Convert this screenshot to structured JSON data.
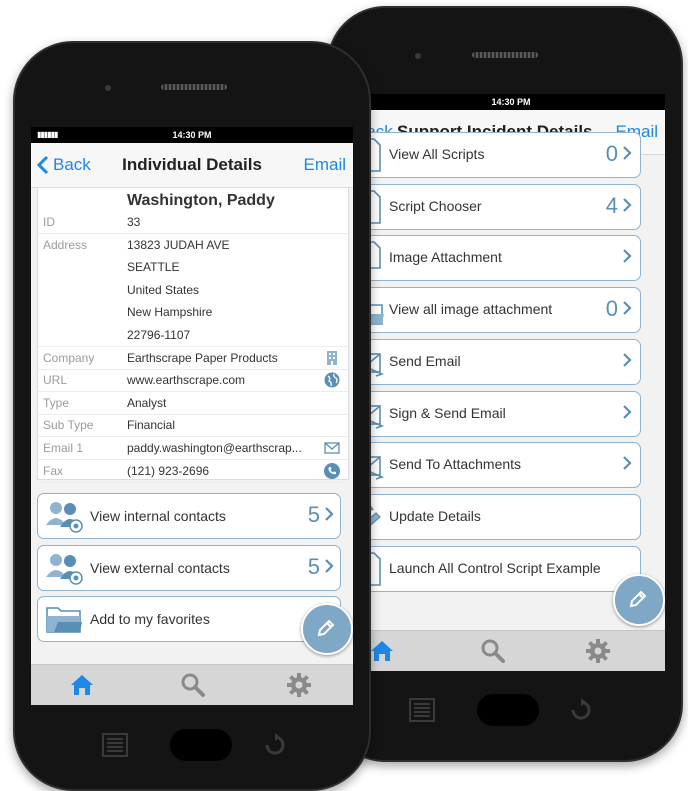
{
  "back_phone": {
    "status_time": "14:30 PM",
    "nav": {
      "back_label": "Back",
      "title": "Support Incident Details",
      "email_label": "Email"
    },
    "items": [
      {
        "label": "View All Scripts",
        "count": "0"
      },
      {
        "label": "Script Chooser",
        "count": "4"
      },
      {
        "label": "Image Attachment",
        "count": ""
      },
      {
        "label": "View all image attachment",
        "count": "0"
      },
      {
        "label": "Send Email",
        "count": ""
      },
      {
        "label": "Sign & Send Email",
        "count": ""
      },
      {
        "label": "Send To Attachments",
        "count": ""
      },
      {
        "label": "Update Details",
        "count": ""
      },
      {
        "label": "Launch All Control Script Example",
        "count": ""
      }
    ]
  },
  "front_phone": {
    "status_time": "14:30 PM",
    "nav": {
      "back_label": "Back",
      "title": "Individual Details",
      "email_label": "Email"
    },
    "name": "Washington, Paddy",
    "fields": [
      {
        "label": "ID",
        "value": "33"
      },
      {
        "label": "Address",
        "value": "13823 JUDAH AVE"
      },
      {
        "label": "",
        "value": "SEATTLE"
      },
      {
        "label": "",
        "value": "United States"
      },
      {
        "label": "",
        "value": "New Hampshire"
      },
      {
        "label": "",
        "value": "22796-1107"
      },
      {
        "label": "Company",
        "value": "Earthscrape Paper Products",
        "icon": "building-icon"
      },
      {
        "label": "URL",
        "value": "www.earthscrape.com",
        "icon": "globe-icon"
      },
      {
        "label": "Type",
        "value": "Analyst"
      },
      {
        "label": "Sub Type",
        "value": "Financial"
      },
      {
        "label": "Email 1",
        "value": "paddy.washington@earthscrap...",
        "icon": "envelope-icon"
      },
      {
        "label": "Fax",
        "value": "(121) 923-2696",
        "icon": "phone-icon"
      }
    ],
    "actions": [
      {
        "label": "View internal contacts",
        "count": "5"
      },
      {
        "label": "View external contacts",
        "count": "5"
      },
      {
        "label": "Add to my favorites",
        "count": ""
      }
    ]
  },
  "colors": {
    "accent": "#1e88e5",
    "card_border": "#8fb4cf",
    "count": "#5a8fb5",
    "fab": "#7fa7c6"
  }
}
